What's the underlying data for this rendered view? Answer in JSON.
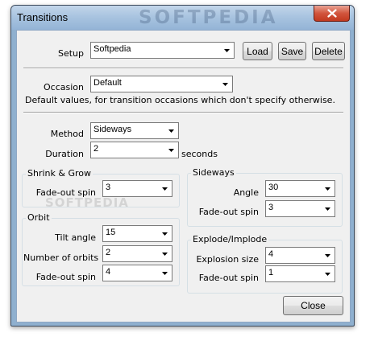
{
  "window": {
    "title": "Transitions",
    "watermark": "SOFTPEDIA"
  },
  "setup": {
    "label": "Setup",
    "value": "Softpedia",
    "load_label": "Load",
    "save_label": "Save",
    "delete_label": "Delete"
  },
  "occasion": {
    "label": "Occasion",
    "value": "Default",
    "description": "Default values, for transition occasions which don't specify otherwise."
  },
  "method": {
    "label": "Method",
    "value": "Sideways"
  },
  "duration": {
    "label": "Duration",
    "value": "2",
    "unit": "seconds"
  },
  "shrink_grow": {
    "title": "Shrink & Grow",
    "fadeout_label": "Fade-out spin",
    "fadeout_value": "3"
  },
  "sideways": {
    "title": "Sideways",
    "angle_label": "Angle",
    "angle_value": "30",
    "fadeout_label": "Fade-out spin",
    "fadeout_value": "3"
  },
  "orbit": {
    "title": "Orbit",
    "tilt_label": "Tilt angle",
    "tilt_value": "15",
    "orbits_label": "Number of orbits",
    "orbits_value": "2",
    "fadeout_label": "Fade-out spin",
    "fadeout_value": "4"
  },
  "explode": {
    "title": "Explode/Implode",
    "size_label": "Explosion size",
    "size_value": "4",
    "fadeout_label": "Fade-out spin",
    "fadeout_value": "1"
  },
  "close_label": "Close",
  "body_watermark": "SOFTPEDIA"
}
